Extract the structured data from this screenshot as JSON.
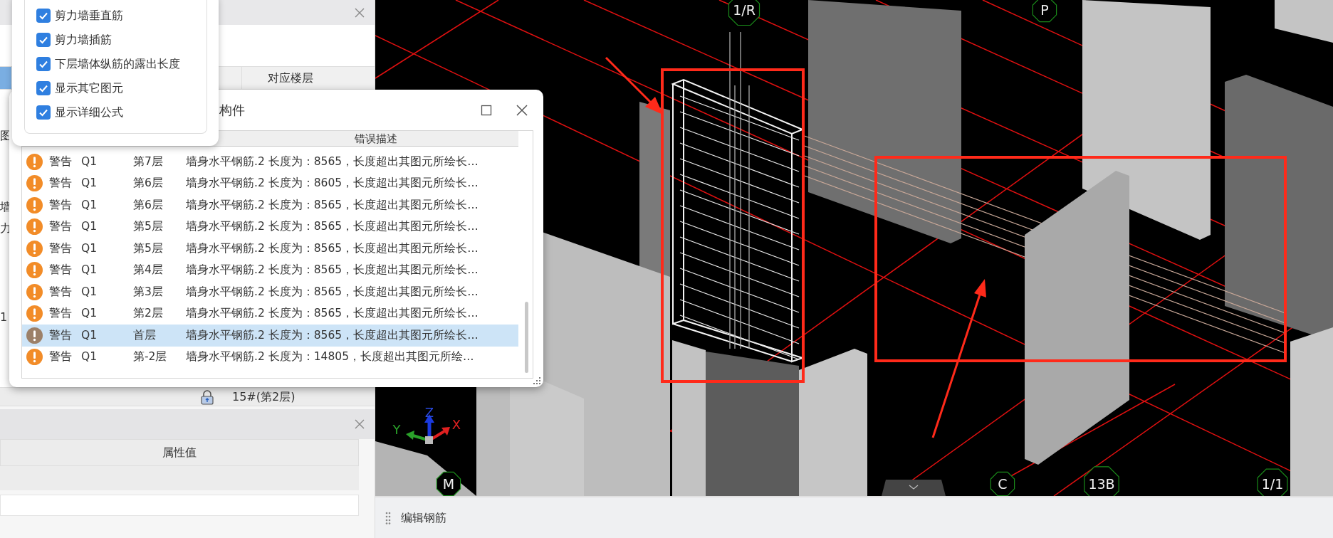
{
  "structure_panel": {
    "column_header": "对应楼层",
    "edge_fragments": [
      "图",
      "墙",
      "力",
      "1"
    ],
    "floor_row": {
      "locked": true,
      "floor": "15#(第2层)"
    }
  },
  "properties_panel": {
    "column_header": "属性值"
  },
  "display_menu": {
    "options": [
      {
        "label": "剪力墙垂直筋",
        "checked": true
      },
      {
        "label": "剪力墙插筋",
        "checked": true
      },
      {
        "label": "下层墙体纵筋的露出长度",
        "checked": true
      },
      {
        "label": "显示其它图元",
        "checked": true
      },
      {
        "label": "显示详细公式",
        "checked": true
      }
    ]
  },
  "error_dialog": {
    "title": "构件",
    "column_header": "错误描述",
    "rows": [
      {
        "severity": "警告",
        "element": "Q1",
        "floor": "第7层",
        "description": "墙身水平钢筋.2 长度为：8565，长度超出其图元所绘长…",
        "selected": false
      },
      {
        "severity": "警告",
        "element": "Q1",
        "floor": "第6层",
        "description": "墙身水平钢筋.2 长度为：8605，长度超出其图元所绘长…",
        "selected": false
      },
      {
        "severity": "警告",
        "element": "Q1",
        "floor": "第6层",
        "description": "墙身水平钢筋.2 长度为：8565，长度超出其图元所绘长…",
        "selected": false
      },
      {
        "severity": "警告",
        "element": "Q1",
        "floor": "第5层",
        "description": "墙身水平钢筋.2 长度为：8565，长度超出其图元所绘长…",
        "selected": false
      },
      {
        "severity": "警告",
        "element": "Q1",
        "floor": "第5层",
        "description": "墙身水平钢筋.2 长度为：8565，长度超出其图元所绘长…",
        "selected": false
      },
      {
        "severity": "警告",
        "element": "Q1",
        "floor": "第4层",
        "description": "墙身水平钢筋.2 长度为：8565，长度超出其图元所绘长…",
        "selected": false
      },
      {
        "severity": "警告",
        "element": "Q1",
        "floor": "第3层",
        "description": "墙身水平钢筋.2 长度为：8565，长度超出其图元所绘长…",
        "selected": false
      },
      {
        "severity": "警告",
        "element": "Q1",
        "floor": "第2层",
        "description": "墙身水平钢筋.2 长度为：8565，长度超出其图元所绘长…",
        "selected": false
      },
      {
        "severity": "警告",
        "element": "Q1",
        "floor": "首层",
        "description": "墙身水平钢筋.2 长度为：8565，长度超出其图元所绘长…",
        "selected": true
      },
      {
        "severity": "警告",
        "element": "Q1",
        "floor": "第-2层",
        "description": "墙身水平钢筋.2 长度为：14805，长度超出其图元所绘…",
        "selected": false
      }
    ]
  },
  "viewport": {
    "axis_labels": [
      "1/R",
      "P",
      "M",
      "C",
      "13B",
      "1/1"
    ],
    "gizmo_labels": [
      "Z",
      "Y",
      "X"
    ]
  },
  "bottom_bar": {
    "title": "编辑钢筋"
  }
}
